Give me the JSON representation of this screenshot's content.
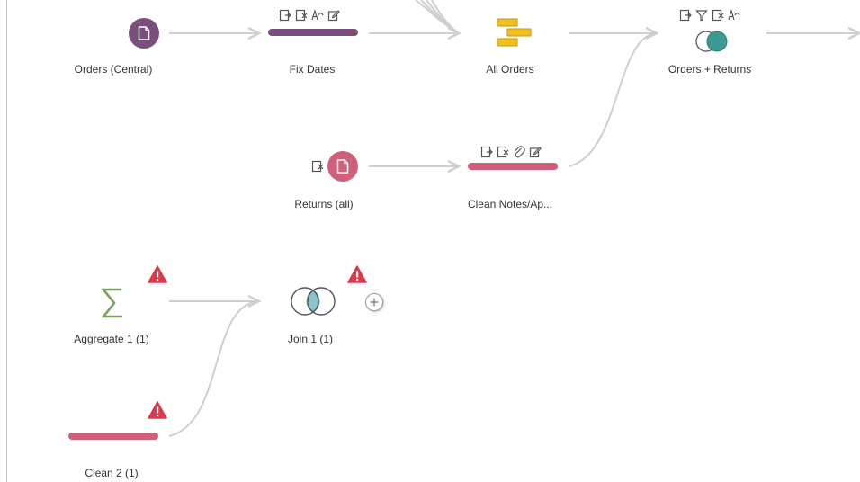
{
  "colors": {
    "input_purple": "#7b4f7c",
    "input_pink": "#d0607a",
    "clean_purple": "#7b4f7c",
    "clean_pink": "#d0607a",
    "union_yellow": "#f0c020",
    "join_teal": "#3b9b93",
    "warning_red": "#e0384b",
    "aggregate_green": "#7aa25c",
    "link_gray": "#cfcfcf"
  },
  "nodes": {
    "orders_central": {
      "label": "Orders (Central)",
      "icon": "file-icon"
    },
    "fix_dates": {
      "label": "Fix Dates",
      "icons": [
        "add-field-icon",
        "remove-field-icon",
        "rename-icon",
        "edit-icon"
      ]
    },
    "all_orders": {
      "label": "All Orders",
      "icon": "union-icon"
    },
    "orders_returns": {
      "label": "Orders + Returns",
      "icons": [
        "add-field-icon",
        "filter-icon",
        "remove-field-icon",
        "rename-icon"
      ]
    },
    "returns_all": {
      "label": "Returns (all)",
      "icon": "file-icon",
      "pre_icon": "remove-field-icon"
    },
    "clean_notes": {
      "label": "Clean Notes/Ap...",
      "icons": [
        "add-field-icon",
        "remove-field-icon",
        "attachment-icon",
        "edit-icon"
      ]
    },
    "aggregate_1": {
      "label": "Aggregate 1 (1)",
      "icon": "sigma-icon",
      "warning": true
    },
    "join_1": {
      "label": "Join 1 (1)",
      "icon": "join-icon",
      "warning": true
    },
    "clean_2": {
      "label": "Clean 2 (1)",
      "warning": true
    }
  }
}
